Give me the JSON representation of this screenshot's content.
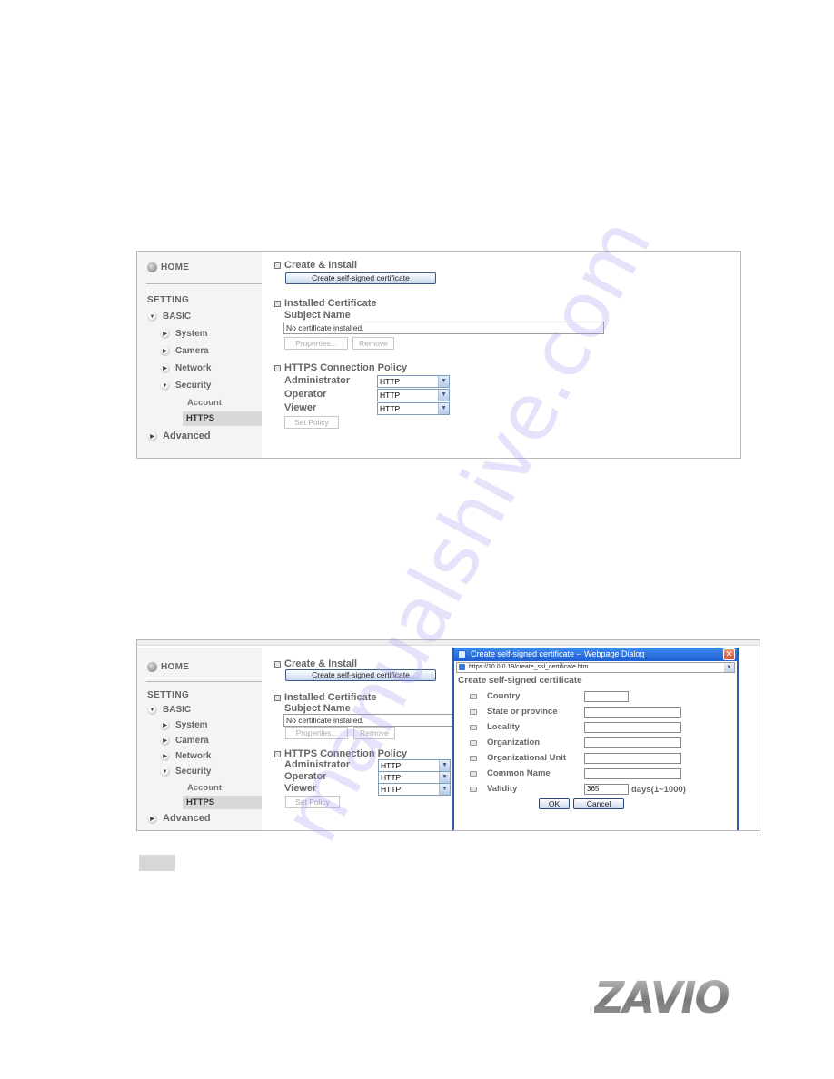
{
  "watermark": "manualshive.com",
  "screenshot1": {
    "sidebar": {
      "home": "HOME",
      "setting": "SETTING",
      "basic": "BASIC",
      "items": [
        "System",
        "Camera",
        "Network",
        "Security"
      ],
      "security_sub": [
        "Account",
        "HTTPS"
      ],
      "active": "HTTPS",
      "advanced": "Advanced"
    },
    "main": {
      "create_install_title": "Create & Install",
      "create_button": "Create self-signed certificate",
      "installed_title": "Installed Certificate",
      "subject_name_label": "Subject Name",
      "subject_name_value": "No certificate installed.",
      "properties_button": "Properties...",
      "remove_button": "Remove",
      "policy_title": "HTTPS Connection Policy",
      "policies": [
        {
          "role": "Administrator",
          "value": "HTTP"
        },
        {
          "role": "Operator",
          "value": "HTTP"
        },
        {
          "role": "Viewer",
          "value": "HTTP"
        }
      ],
      "set_policy_button": "Set Policy"
    }
  },
  "dialog": {
    "window_title": "Create self-signed certificate -- Webpage Dialog",
    "address": "https://10.0.0.19/create_ssl_certificate.htm",
    "heading": "Create self-signed certificate",
    "fields": [
      {
        "label": "Country",
        "value": ""
      },
      {
        "label": "State or province",
        "value": ""
      },
      {
        "label": "Locality",
        "value": ""
      },
      {
        "label": "Organization",
        "value": ""
      },
      {
        "label": "Organizational Unit",
        "value": ""
      },
      {
        "label": "Common Name",
        "value": ""
      },
      {
        "label": "Validity",
        "value": "365"
      }
    ],
    "validity_suffix": "days(1~1000)",
    "ok_button": "OK",
    "cancel_button": "Cancel"
  },
  "logo": "ZAVIO"
}
